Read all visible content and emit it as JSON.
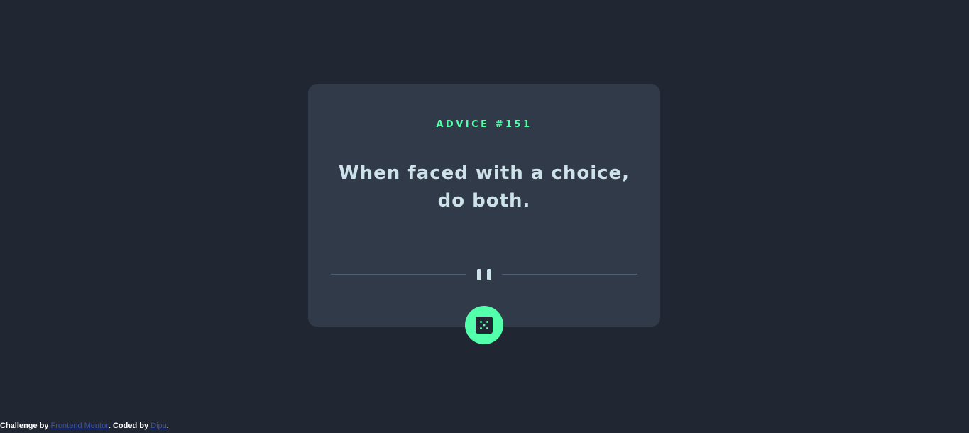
{
  "card": {
    "advice_label": "ADVICE #151",
    "quote": "When faced with a choice, do both."
  },
  "divider": {
    "icon": "pause-icon"
  },
  "dice_button": {
    "icon": "dice-icon"
  },
  "footer": {
    "prefix": "Challenge by ",
    "challenge_link": "Frontend Mentor",
    "middle": ". Coded by ",
    "author_link": "Dipu",
    "suffix": "."
  },
  "colors": {
    "background": "#202733",
    "card": "#313a48",
    "accent": "#53ffaa",
    "text": "#cee3e9",
    "link": "#3e52a3"
  }
}
